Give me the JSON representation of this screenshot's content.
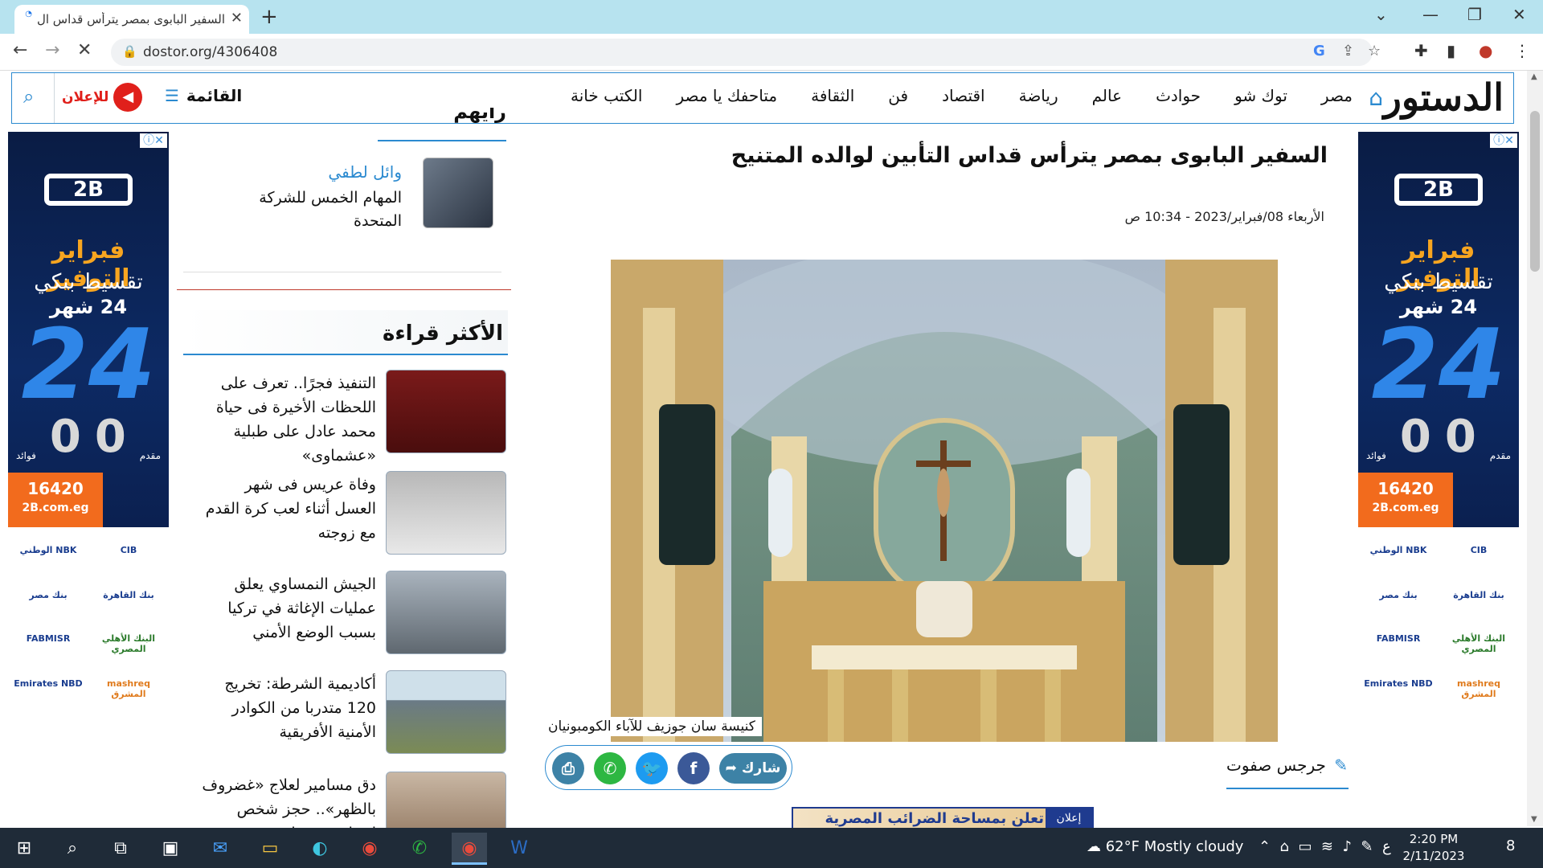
{
  "browser": {
    "tab_title": "السفير البابوى بمصر يترأس قداس ال",
    "tab_close": "✕",
    "new_tab": "+",
    "url": "dostor.org/4306408",
    "min": "⌄",
    "minimize": "—",
    "restore": "❐",
    "close": "✕"
  },
  "site": {
    "logo": "الدستور",
    "nav": [
      "مصر",
      "توك شو",
      "حوادث",
      "عالم",
      "رياضة",
      "اقتصاد",
      "فن",
      "الثقافة",
      "متاحفك يا مصر",
      "الكتب خانة"
    ],
    "menu_label": "القائمة",
    "ads_label": "للإعلان"
  },
  "ad": {
    "brand": "2B",
    "headline": "فبراير التوفير",
    "line1": "تقسيط بنكي",
    "line2": "24 شهر",
    "big": "24",
    "zero_left": "0",
    "zero_right": "0",
    "zero_left_label": "مقدم",
    "zero_right_label": "فوائد",
    "hotline": "16420",
    "site": "2B.com.eg",
    "banks": [
      "CIB",
      "الوطني NBK",
      "بنك القاهرة",
      "بنك مصر",
      "البنك الأهلي المصري",
      "FABMISR",
      "mashreq المشرق",
      "Emirates NBD"
    ]
  },
  "sidebar": {
    "writers_title": "رأيهم",
    "writer_name": "وائل لطفي",
    "writer_article": "المهام الخمس للشركة المتحدة",
    "most_read_title": "الأكثر قراءة",
    "most_read": [
      "التنفيذ فجرًا.. تعرف على اللحظات الأخيرة فى حياة محمد عادل على طبلية «عشماوى»",
      "وفاة عريس فى شهر العسل أثناء لعب كرة القدم مع زوجته",
      "الجيش النمساوي يعلق عمليات الإغاثة في تركيا بسبب الوضع الأمني",
      "أكاديمية الشرطة: تخريج 120 متدربا من الكوادر الأمنية الأفريقية",
      "دق مسامير لعلاج «غضروف بالظهر».. حجز شخص انتحل صفة طبيب"
    ]
  },
  "article": {
    "title": "السفير البابوى بمصر يترأس قداس التأبين لوالده المتنيح",
    "date": "الأربعاء 08/فبراير/2023 - 10:34 ص",
    "caption": "كنيسة سان جوزيف للآباء الكومبونيان",
    "share_label": "شارك",
    "author": "جرجس صفوت",
    "bottom_ad_label": "إعلان",
    "bottom_ad_text": "تعلن بمساحة الضرائب المصرية"
  },
  "taskbar": {
    "weather": "62°F  Mostly cloudy",
    "time": "2:20 PM",
    "date": "2/11/2023",
    "notifications": "8",
    "lang": "ع"
  },
  "colors": {
    "accent": "#2b8ad0",
    "red": "#e0201b",
    "tab_strip": "#b7e3ef",
    "taskbar": "#1f2b38"
  }
}
